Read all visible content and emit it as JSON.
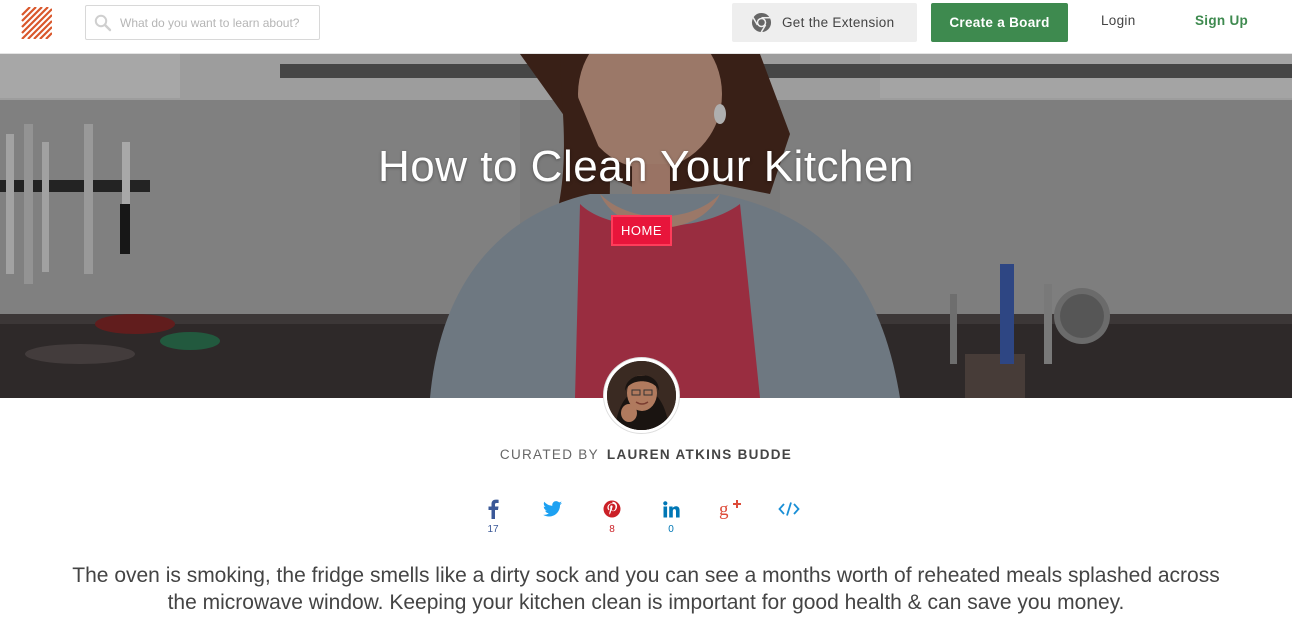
{
  "header": {
    "search_placeholder": "What do you want to learn about?",
    "extension_label": "Get the Extension",
    "create_board_label": "Create a Board",
    "login_label": "Login",
    "signup_label": "Sign Up"
  },
  "hero": {
    "title": "How to Clean Your Kitchen",
    "category_tag": "HOME"
  },
  "curator": {
    "prefix": "CURATED BY",
    "name": "LAUREN ATKINS BUDDE"
  },
  "share": [
    {
      "name": "facebook",
      "icon": "facebook-icon",
      "count": "17",
      "color": "#3b5998"
    },
    {
      "name": "twitter",
      "icon": "twitter-icon",
      "count": "",
      "color": "#1da1f2"
    },
    {
      "name": "pinterest",
      "icon": "pinterest-icon",
      "count": "8",
      "color": "#cb2027"
    },
    {
      "name": "linkedin",
      "icon": "linkedin-icon",
      "count": "0",
      "color": "#0077b5"
    },
    {
      "name": "google-plus",
      "icon": "google-plus-icon",
      "count": "",
      "color": "#dd4b39"
    },
    {
      "name": "embed",
      "icon": "embed-icon",
      "count": "",
      "color": "#1a8fd6"
    }
  ],
  "description": "The oven is smoking, the fridge smells like a dirty sock and you can see a months worth of reheated meals splashed across the microwave window. Keeping your kitchen clean is important for good health & can save you money.",
  "colors": {
    "brand_green": "#3e8a4f",
    "tag_red": "#e8153b",
    "logo_orange": "#d9572b"
  }
}
